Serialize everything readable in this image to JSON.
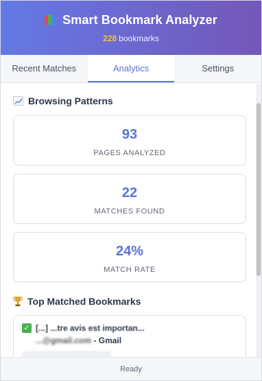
{
  "header": {
    "title": "Smart Bookmark Analyzer",
    "bookmark_count": "228",
    "bookmark_suffix": "bookmarks",
    "logo_icon": "bookmark-stack-icon"
  },
  "tabs": [
    {
      "label": "Recent Matches",
      "active": false
    },
    {
      "label": "Analytics",
      "active": true
    },
    {
      "label": "Settings",
      "active": false
    }
  ],
  "browsing_patterns": {
    "title": "Browsing Patterns",
    "icon": "chart-increasing-icon",
    "stats": [
      {
        "value": "93",
        "label": "PAGES ANALYZED"
      },
      {
        "value": "22",
        "label": "MATCHES FOUND"
      },
      {
        "value": "24%",
        "label": "MATCH RATE"
      }
    ]
  },
  "top_matched": {
    "title": "Top Matched Bookmarks",
    "icon": "trophy-icon",
    "items": [
      {
        "title_line1": "[...] ...tre avis est importan...",
        "title_line2_blurred": "...@gmail.com",
        "title_line2_suffix": "- Gmail"
      }
    ]
  },
  "footer": {
    "status": "Ready"
  },
  "colors": {
    "header_gradient_start": "#6479e6",
    "header_gradient_end": "#7457b8",
    "accent": "#5b6fd9",
    "count_highlight": "#f6c244",
    "check_green": "#4caf50"
  }
}
